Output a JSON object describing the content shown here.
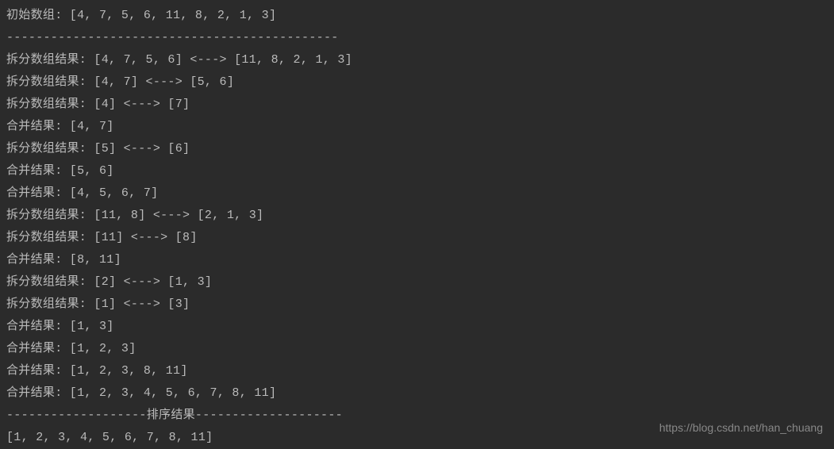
{
  "console": {
    "lines": [
      "初始数组: [4, 7, 5, 6, 11, 8, 2, 1, 3]",
      "---------------------------------------------",
      "拆分数组结果: [4, 7, 5, 6] <---> [11, 8, 2, 1, 3]",
      "拆分数组结果: [4, 7] <---> [5, 6]",
      "拆分数组结果: [4] <---> [7]",
      "合并结果: [4, 7]",
      "拆分数组结果: [5] <---> [6]",
      "合并结果: [5, 6]",
      "合并结果: [4, 5, 6, 7]",
      "拆分数组结果: [11, 8] <---> [2, 1, 3]",
      "拆分数组结果: [11] <---> [8]",
      "合并结果: [8, 11]",
      "拆分数组结果: [2] <---> [1, 3]",
      "拆分数组结果: [1] <---> [3]",
      "合并结果: [1, 3]",
      "合并结果: [1, 2, 3]",
      "合并结果: [1, 2, 3, 8, 11]",
      "合并结果: [1, 2, 3, 4, 5, 6, 7, 8, 11]",
      "-------------------排序结果--------------------",
      "[1, 2, 3, 4, 5, 6, 7, 8, 11]"
    ]
  },
  "watermark": "https://blog.csdn.net/han_chuang"
}
